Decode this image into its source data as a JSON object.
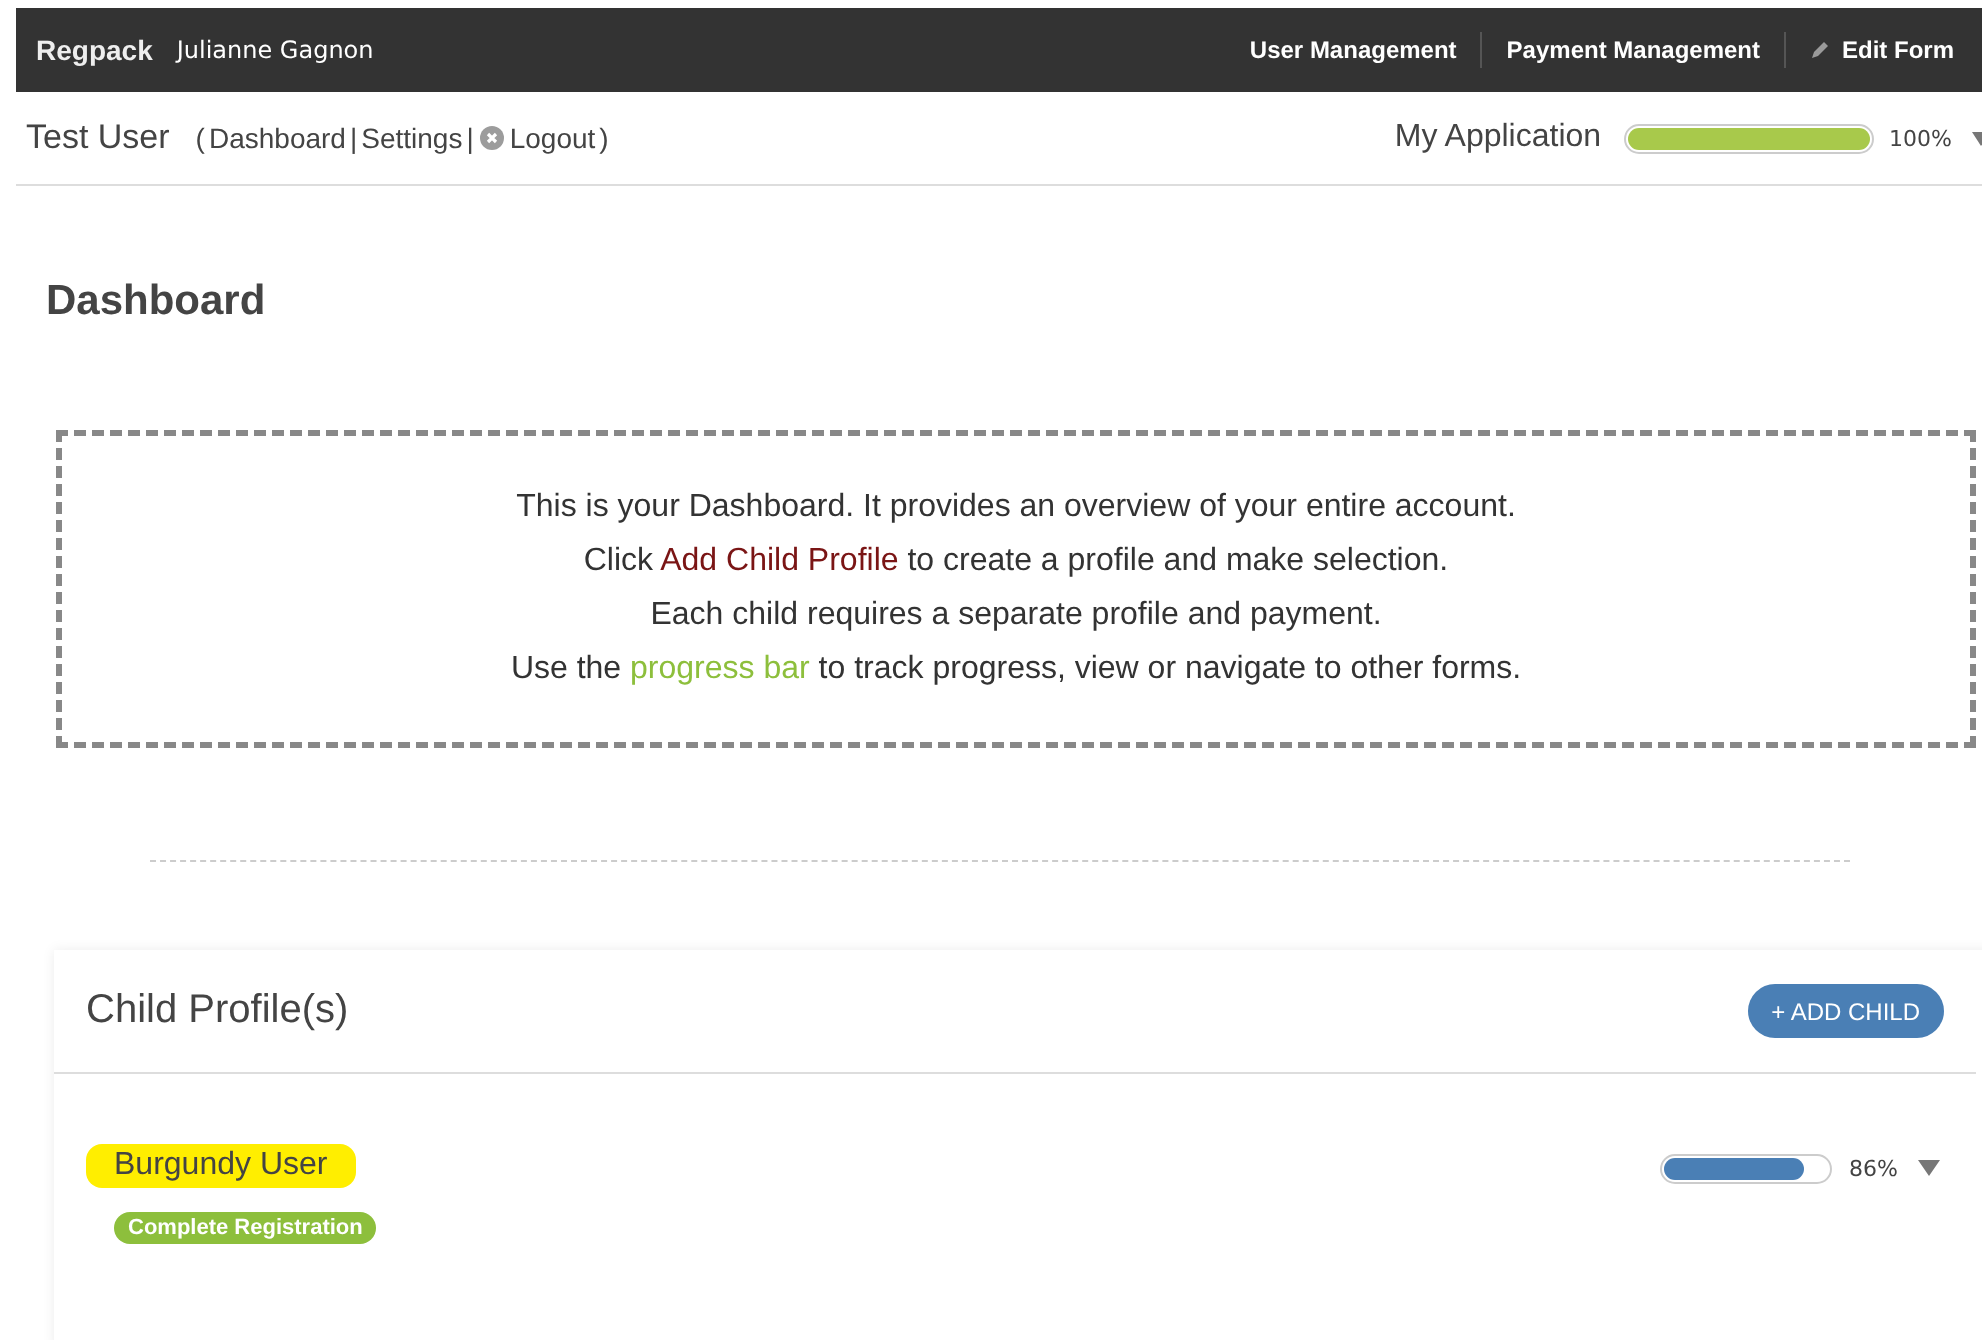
{
  "top_bar": {
    "logo": "Regpack",
    "user": "Julianne Gagnon",
    "nav": [
      {
        "label": "User Management",
        "kind": "plain"
      },
      {
        "label": "Payment Management",
        "kind": "plain"
      },
      {
        "label": "Edit Form",
        "kind": "edit"
      }
    ]
  },
  "sub_bar": {
    "title": "Test User",
    "links": [
      {
        "label": "(",
        "kind": "punct"
      },
      {
        "label": "Dashboard",
        "kind": "link"
      },
      {
        "label": "|",
        "kind": "punct"
      },
      {
        "label": "Settings",
        "kind": "link"
      },
      {
        "label": "|",
        "kind": "punct"
      },
      {
        "label": "Logout",
        "kind": "logout"
      },
      {
        "label": ")",
        "kind": "punct"
      }
    ],
    "application": {
      "label": "My Application",
      "level": 1.0,
      "reading": "100%"
    }
  },
  "page_title": "Dashboard",
  "info_lines": [
    [
      {
        "kind": "plain",
        "text": "This is your Dashboard. It provides an overview of your entire account."
      }
    ],
    [
      {
        "kind": "plain",
        "text": "Click "
      },
      {
        "kind": "link",
        "text": "Add Child Profile"
      },
      {
        "kind": "plain",
        "text": " to create a profile and make selection."
      }
    ],
    [
      {
        "kind": "plain",
        "text": "Each child requires a separate profile and payment."
      }
    ],
    [
      {
        "kind": "plain",
        "text": "Use the "
      },
      {
        "kind": "accent",
        "text": "progress bar"
      },
      {
        "kind": "plain",
        "text": " to track progress, view or navigate to other forms."
      }
    ]
  ],
  "profiles_card": {
    "title": "Child Profile(s)",
    "add_button": "+ ADD CHILD",
    "children": [
      {
        "name": "Burgundy User",
        "highlighted": true,
        "badge": "Complete Registration",
        "level": 0.86,
        "reading": "86%"
      }
    ]
  }
}
